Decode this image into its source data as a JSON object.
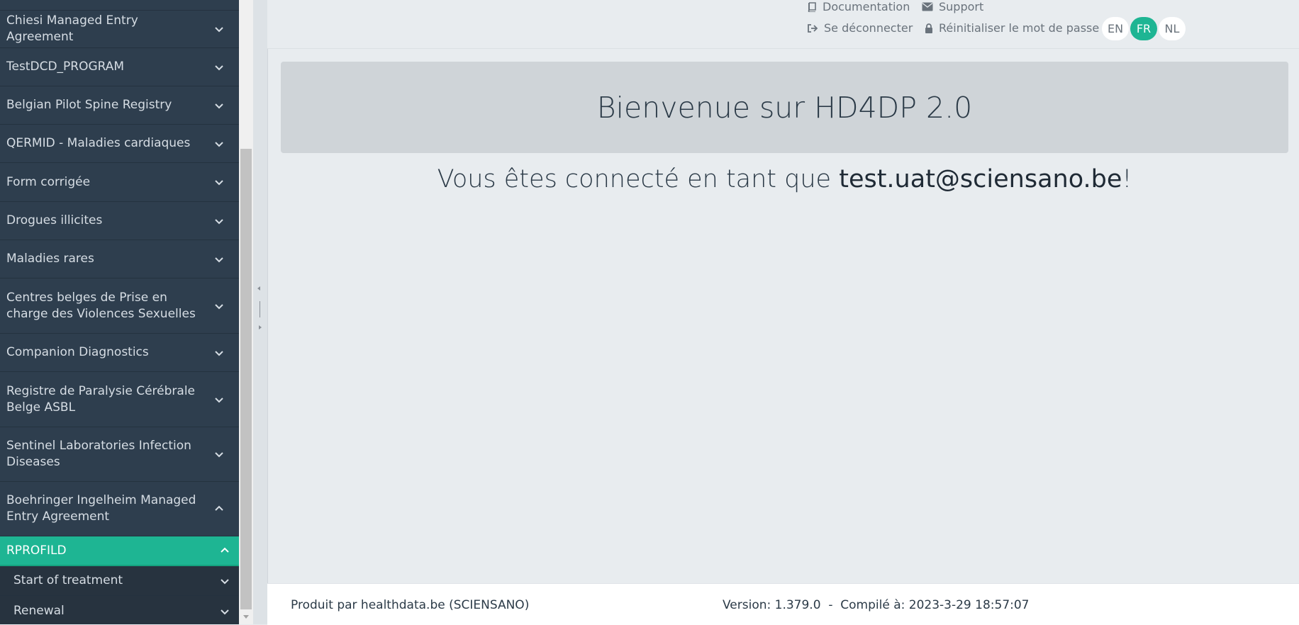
{
  "sidebar": {
    "items": [
      {
        "label": "Chiesi Managed Entry Agreement"
      },
      {
        "label": "TestDCD_PROGRAM"
      },
      {
        "label": "Belgian Pilot Spine Registry"
      },
      {
        "label": "QERMID - Maladies cardiaques"
      },
      {
        "label": "Form corrigée"
      },
      {
        "label": "Drogues illicites"
      },
      {
        "label": "Maladies rares"
      },
      {
        "label": "Centres belges de Prise en charge des Violences Sexuelles"
      },
      {
        "label": "Companion Diagnostics"
      },
      {
        "label": "Registre de Paralysie Cérébrale Belge ASBL"
      },
      {
        "label": "Sentinel Laboratories Infection Diseases"
      },
      {
        "label": "Boehringer Ingelheim Managed Entry Agreement"
      },
      {
        "label": "RPROFILD"
      },
      {
        "label": "Start of treatment"
      },
      {
        "label": "Renewal"
      }
    ]
  },
  "header": {
    "documentation": "Documentation",
    "support": "Support",
    "logout": "Se déconnecter",
    "reset_password": "Réinitialiser le mot de passe",
    "languages": [
      "EN",
      "FR",
      "NL"
    ],
    "active_language": "FR"
  },
  "main": {
    "welcome_title": "Bienvenue sur HD4DP 2.0",
    "connected_prefix": "Vous êtes connecté en tant que ",
    "user_email": "test.uat@sciensano.be",
    "connected_suffix": "!"
  },
  "footer": {
    "produced_by": "Produit par healthdata.be (SCIENSANO)",
    "version": "Version: 1.379.0  -  Compilé à: 2023-3-29 18:57:07"
  },
  "colors": {
    "sidebar_bg": "#2e3e4e",
    "accent": "#1eb593",
    "main_bg": "#e8ecef"
  }
}
